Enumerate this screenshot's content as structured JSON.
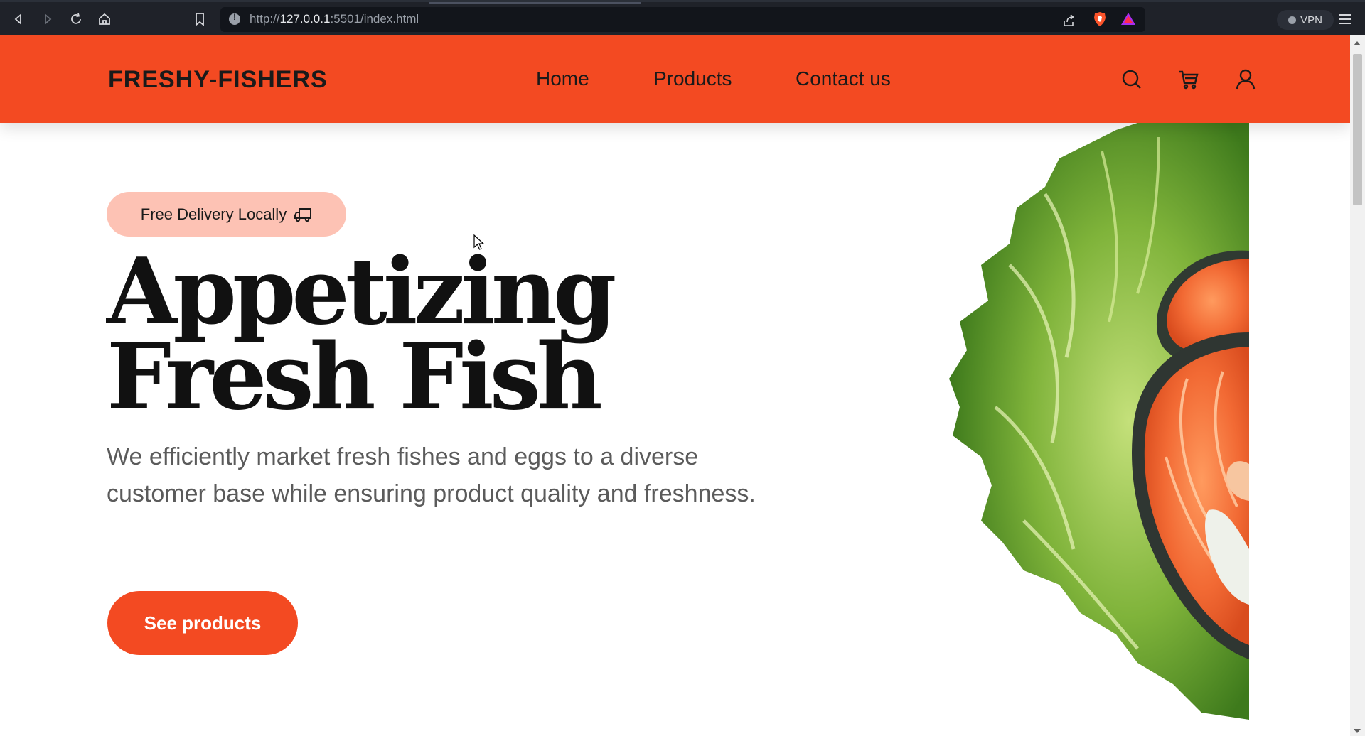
{
  "browser": {
    "url_scheme": "http://",
    "url_host": "127.0.0.1",
    "url_rest": ":5501/index.html",
    "vpn_label": "VPN",
    "icons": [
      "back-icon",
      "forward-icon",
      "reload-icon",
      "home-icon",
      "bookmark-icon",
      "share-icon",
      "brave-shield-icon",
      "rewards-icon",
      "menu-icon"
    ]
  },
  "header": {
    "logo": "FRESHY-FISHERS",
    "nav": [
      "Home",
      "Products",
      "Contact us"
    ],
    "icons": [
      "search-icon",
      "cart-icon",
      "user-icon"
    ]
  },
  "hero": {
    "badge": "Free Delivery Locally",
    "badge_icon": "delivery-truck-icon",
    "headline": "Appetizing Fresh Fish",
    "lead": "We efficiently market fresh fishes and eggs to a diverse customer base while ensuring product quality and freshness.",
    "cta": "See products"
  },
  "colors": {
    "brand": "#f34a22",
    "badge_bg": "#fdc2b4",
    "headline": "#111111",
    "lead": "#5b5b5b"
  }
}
